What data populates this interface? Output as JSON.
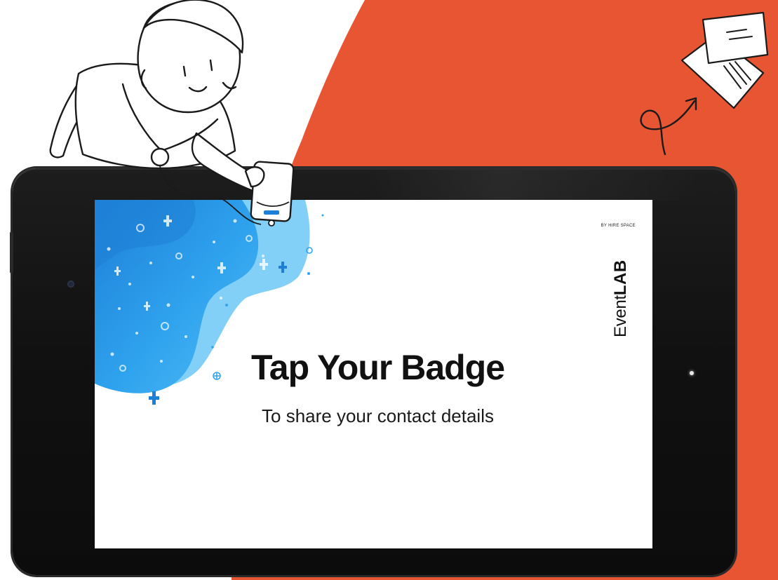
{
  "screen": {
    "byline": "BY HIRE SPACE",
    "brand_light": "Event",
    "brand_bold": "LAB",
    "headline": "Tap Your Badge",
    "subheadline": "To share your contact details"
  },
  "colors": {
    "accent_orange": "#E85532",
    "blob_dark_blue": "#1E7FD6",
    "blob_mid_blue": "#2FA3EE",
    "blob_light_blue": "#6CC8F7",
    "tablet_black": "#111111",
    "text_dark": "#111111"
  },
  "icons": {
    "illustration": "person-holding-badge-illustration",
    "cards": "contact-cards-icon",
    "arrow": "curly-arrow-icon",
    "badge": "nfc-badge-icon"
  }
}
